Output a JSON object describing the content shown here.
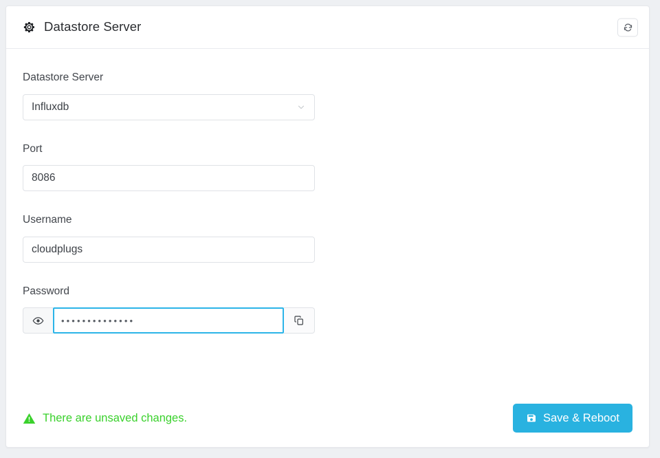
{
  "header": {
    "title": "Datastore Server",
    "gear_icon": "gear-icon",
    "refresh_icon": "refresh-icon"
  },
  "form": {
    "datastore": {
      "label": "Datastore Server",
      "value": "Influxdb",
      "chevron_icon": "chevron-down-icon"
    },
    "port": {
      "label": "Port",
      "value": "8086"
    },
    "username": {
      "label": "Username",
      "value": "cloudplugs"
    },
    "password": {
      "label": "Password",
      "value": "••••••••••••••",
      "eye_icon": "eye-icon",
      "copy_icon": "copy-icon"
    }
  },
  "footer": {
    "unsaved_text": "There are unsaved changes.",
    "warning_icon": "warning-triangle-icon",
    "save_label": "Save & Reboot",
    "save_icon": "floppy-save-icon"
  },
  "colors": {
    "accent_blue": "#29b2e0",
    "focus_blue": "#2bb4e8",
    "success_green": "#3ad12c",
    "page_bg": "#eef0f3",
    "border": "#dfe2e6"
  }
}
